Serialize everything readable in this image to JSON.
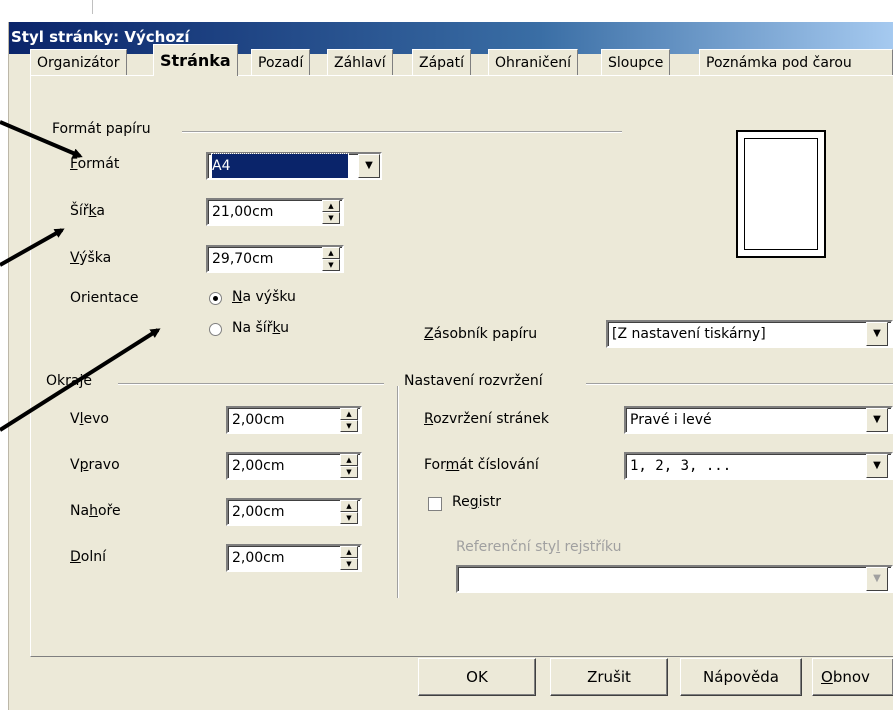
{
  "dialog": {
    "title": "Styl stránky: Výchozí",
    "tabs": [
      "Organizátor",
      "Stránka",
      "Pozadí",
      "Záhlaví",
      "Zápatí",
      "Ohraničení",
      "Sloupce",
      "Poznámka pod čarou"
    ],
    "active_tab": "Stránka"
  },
  "paper_format": {
    "group_label": "Formát papíru",
    "format_label_first": "F",
    "format_label_rest": "ormát",
    "format_value": "A4",
    "width_label_a": "Šíř",
    "width_label_u": "k",
    "width_label_b": "a",
    "width_value": "21,00cm",
    "height_label_u": "V",
    "height_label_rest": "ýška",
    "height_value": "29,70cm",
    "orientation_label": "Orientace",
    "portrait_u": "N",
    "portrait_rest": "a výšku",
    "landscape_a": "Na šíř",
    "landscape_u": "k",
    "landscape_b": "u",
    "orientation_selected": "portrait",
    "tray_u": "Z",
    "tray_rest": "ásobník papíru",
    "tray_value": "[Z nastavení tiskárny]"
  },
  "margins": {
    "group_label": "Okraje",
    "left_a": "V",
    "left_u": "l",
    "left_b": "evo",
    "left_value": "2,00cm",
    "right_a": "V",
    "right_u": "p",
    "right_b": "ravo",
    "right_value": "2,00cm",
    "top_a": "Na",
    "top_u": "h",
    "top_b": "oře",
    "top_value": "2,00cm",
    "bottom_u": "D",
    "bottom_rest": "olní",
    "bottom_value": "2,00cm"
  },
  "layout": {
    "group_label": "Nastavení rozvržení",
    "page_layout_u": "R",
    "page_layout_rest": "ozvržení stránek",
    "page_layout_value": "Pravé i levé",
    "numbering_a": "For",
    "numbering_u": "m",
    "numbering_b": "át číslování",
    "numbering_value": "1, 2, 3, ...",
    "register_a": "Re",
    "register_u": "g",
    "register_b": "istr",
    "register_checked": false,
    "ref_style_a": "Referenční sty",
    "ref_style_u": "l",
    "ref_style_b": " rejstříku",
    "ref_style_value": ""
  },
  "buttons": {
    "ok": "OK",
    "cancel": "Zrušit",
    "help": "Nápověda",
    "reset_u": "O",
    "reset_rest": "bnov"
  },
  "icons": {
    "dropdown": "triangle-down-icon",
    "spin_up": "triangle-up-icon",
    "spin_down": "triangle-down-icon",
    "arrow": "annotation-arrow"
  }
}
